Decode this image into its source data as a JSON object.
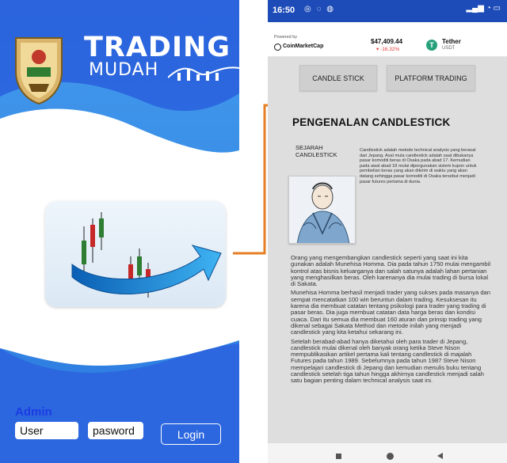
{
  "colors": {
    "primary_blue": "#1d4cb8",
    "light_blue": "#3d8ee6",
    "connector_orange": "#e67e22",
    "admin_blue": "#1c3be3",
    "price_down": "#e53935",
    "tether_green": "#26a17b"
  },
  "login_screen": {
    "brand_title": "TRADING",
    "brand_subtitle": "MUDAH",
    "logo_icon": "university-crest-logo",
    "hero_icon": "candlestick-arrow-illustration",
    "admin_label": "Admin",
    "username_value": "User",
    "password_value": "pasword",
    "login_label": "Login"
  },
  "status_bar": {
    "time": "16:50",
    "left_icons": "signal-notification-icons",
    "right_icons": "network-wifi-battery-icons"
  },
  "ticker": {
    "powered_by": "Powered by",
    "provider": "CoinMarketCap",
    "price": "$47,409.44",
    "change": "▾ -16.32%",
    "coin_symbol_glyph": "T",
    "coin_name": "Tether",
    "coin_ticker": "USDT"
  },
  "tabs": {
    "candle_stick": "CANDLE STICK",
    "platform_trading": "PLATFORM TRADING"
  },
  "article": {
    "title": "PENGENALAN CANDLESTICK",
    "sub_heading": "SEJARAH CANDLESTICK",
    "intro": "Candlestick adalah metode technical analysis yang berasal dari Jepang. Asal mula candlestick adalah saat dibukanya pasar komoditi beras di Osaka pada abad 17. Kemudian pada awal abad 18 mulai dipergunakan sistem kupon untuk pembelian beras yang akan dikirim di waktu yang akan datang sehingga pasar komoditi di Osaka tersebut menjadi pasar futures pertama di dunia.",
    "paragraph_1": "Orang yang mengembangkan candlestick seperti yang saat ini kita gunakan adalah Munehisa Homma. Dia pada tahun 1750 mulai mengambil kontrol atas bisnis keluarganya dan salah satunya adalah lahan pertanian yang menghasilkan beras. Oleh karenanya dia mulai trading di bursa lokal di Sakata.",
    "paragraph_2": "Munehisa Homma berhasil menjadi trader yang sukses pada masanya dan sempat mencatatkan 100 win beruntun dalam trading. Kesuksesan itu karena dia membuat catatan tentang psikologi para trader yang trading di pasar beras. Dia juga membuat catatan data harga beras dan kondisi cuaca. Dari itu semua dia membuat 160 aturan dan prinsip trading yang dikenal sebagai Sakata Method dan metode inilah yang menjadi candlestick yang kita ketahui sekarang ini.",
    "paragraph_3": "Setelah berabad-abad hanya diketahui oleh para trader di Jepang, candlestick mulai dikenal oleh banyak orang ketika Steve Nison mempublikasikan artikel pertama kali tentang candlestick di majalah Futures pada tahun 1989. Sebelumnya pada tahun 1987 Steve Nison mempelajari candlestick di Jepang dan kemudian menulis buku tentang candlestick setelah tiga tahun hingga akhirnya candlestick menjadi salah satu bagian penting dalam technical analysis saat ini."
  }
}
